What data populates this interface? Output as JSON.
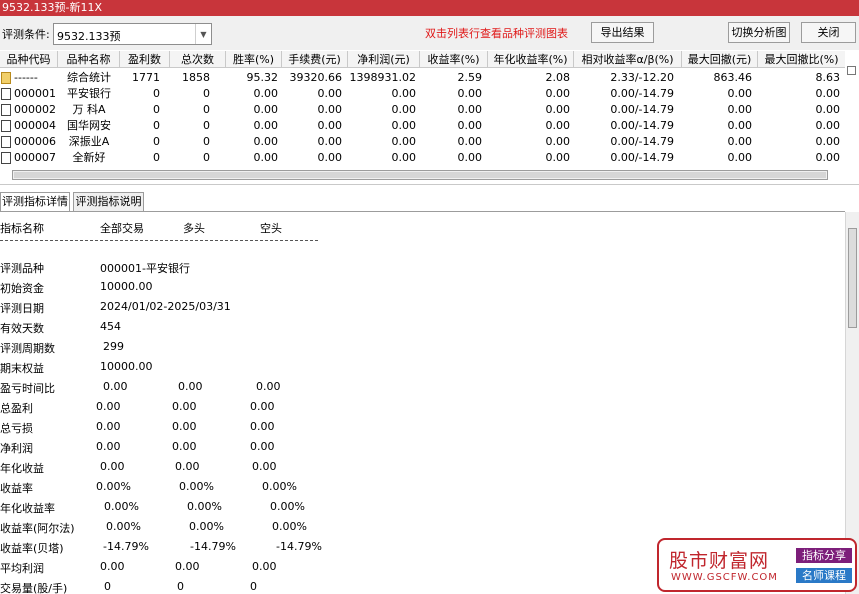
{
  "window": {
    "title": "9532.133预-新11X"
  },
  "toolbar": {
    "condition_label": "评测条件:",
    "condition_value": "9532.133预",
    "hint": "双击列表行查看品种评测图表",
    "export_label": "导出结果",
    "switch_chart_label": "切换分析图",
    "close_label": "关闭"
  },
  "grid": {
    "headers": [
      "品种代码",
      "品种名称",
      "盈利数",
      "总次数",
      "胜率(%)",
      "手续费(元)",
      "净利润(元)",
      "收益率(%)",
      "年化收益率(%)",
      "相对收益率α/β(%)",
      "最大回撤(元)",
      "最大回撤比(%)"
    ],
    "rows": [
      {
        "code": "------",
        "name": "综合统计",
        "wins": "1771",
        "total": "1858",
        "winrate": "95.32",
        "fee": "39320.66",
        "net": "1398931.02",
        "ret": "2.59",
        "annual": "2.08",
        "relative": "2.33/-12.20",
        "maxdd": "863.46",
        "maxddr": "8.63"
      },
      {
        "code": "000001",
        "name": "平安银行",
        "wins": "0",
        "total": "0",
        "winrate": "0.00",
        "fee": "0.00",
        "net": "0.00",
        "ret": "0.00",
        "annual": "0.00",
        "relative": "0.00/-14.79",
        "maxdd": "0.00",
        "maxddr": "0.00"
      },
      {
        "code": "000002",
        "name": "万 科A",
        "wins": "0",
        "total": "0",
        "winrate": "0.00",
        "fee": "0.00",
        "net": "0.00",
        "ret": "0.00",
        "annual": "0.00",
        "relative": "0.00/-14.79",
        "maxdd": "0.00",
        "maxddr": "0.00"
      },
      {
        "code": "000004",
        "name": "国华网安",
        "wins": "0",
        "total": "0",
        "winrate": "0.00",
        "fee": "0.00",
        "net": "0.00",
        "ret": "0.00",
        "annual": "0.00",
        "relative": "0.00/-14.79",
        "maxdd": "0.00",
        "maxddr": "0.00"
      },
      {
        "code": "000006",
        "name": "深振业A",
        "wins": "0",
        "total": "0",
        "winrate": "0.00",
        "fee": "0.00",
        "net": "0.00",
        "ret": "0.00",
        "annual": "0.00",
        "relative": "0.00/-14.79",
        "maxdd": "0.00",
        "maxddr": "0.00"
      },
      {
        "code": "000007",
        "name": "全新好",
        "wins": "0",
        "total": "0",
        "winrate": "0.00",
        "fee": "0.00",
        "net": "0.00",
        "ret": "0.00",
        "annual": "0.00",
        "relative": "0.00/-14.79",
        "maxdd": "0.00",
        "maxddr": "0.00"
      }
    ]
  },
  "tabs": {
    "detail": "评测指标详情",
    "explain": "评测指标说明"
  },
  "detail": {
    "header": {
      "name": "指标名称",
      "all": "全部交易",
      "long": "多头",
      "short": "空头"
    },
    "info": [
      {
        "label": "评测品种",
        "value": "000001-平安银行"
      },
      {
        "label": "初始资金",
        "value": "10000.00"
      },
      {
        "label": "评测日期",
        "value": "2024/01/02-2025/03/31"
      },
      {
        "label": "有效天数",
        "value": "454"
      },
      {
        "label": "评测周期数",
        "value": "299"
      },
      {
        "label": "期末权益",
        "value": "10000.00"
      }
    ],
    "metrics": [
      {
        "label": "盈亏时间比",
        "all": "0.00",
        "long": "0.00",
        "short": "0.00"
      },
      {
        "label": "总盈利",
        "all": "0.00",
        "long": "0.00",
        "short": "0.00"
      },
      {
        "label": "总亏损",
        "all": "0.00",
        "long": "0.00",
        "short": "0.00"
      },
      {
        "label": "净利润",
        "all": "0.00",
        "long": "0.00",
        "short": "0.00"
      },
      {
        "label": "年化收益",
        "all": "0.00",
        "long": "0.00",
        "short": "0.00"
      },
      {
        "label": "收益率",
        "all": "0.00%",
        "long": "0.00%",
        "short": "0.00%"
      },
      {
        "label": "年化收益率",
        "all": "0.00%",
        "long": "0.00%",
        "short": "0.00%"
      },
      {
        "label": "收益率(阿尔法)",
        "all": "0.00%",
        "long": "0.00%",
        "short": "0.00%"
      },
      {
        "label": "收益率(贝塔)",
        "all": "-14.79%",
        "long": "-14.79%",
        "short": "-14.79%"
      },
      {
        "label": "平均利润",
        "all": "0.00",
        "long": "0.00",
        "short": "0.00"
      },
      {
        "label": "交易量(股/手)",
        "all": "0",
        "long": "0",
        "short": "0"
      }
    ]
  },
  "watermark": {
    "brand": "股市财富网",
    "url": "WWW.GSCFW.COM",
    "tag1": "指标分享",
    "tag2": "名师课程",
    "color": "#c0262d"
  }
}
